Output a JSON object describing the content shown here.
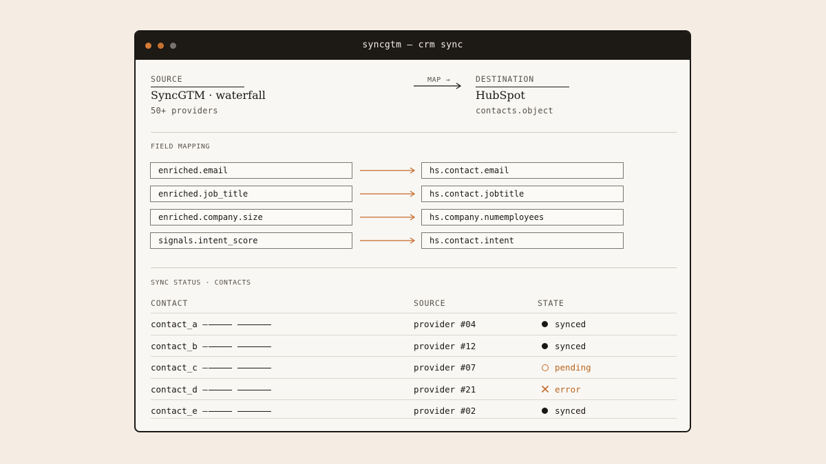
{
  "window": {
    "title": "syncgtm — crm sync"
  },
  "source": {
    "label": "SOURCE",
    "name": "SyncGTM · waterfall",
    "detail": "50+ providers"
  },
  "map_label": "MAP →",
  "destination": {
    "label": "DESTINATION",
    "name": "HubSpot",
    "detail": "contacts.object"
  },
  "field_mapping": {
    "heading": "FIELD MAPPING",
    "rows": [
      {
        "from": "enriched.email",
        "to": "hs.contact.email"
      },
      {
        "from": "enriched.job_title",
        "to": "hs.contact.jobtitle"
      },
      {
        "from": "enriched.company.size",
        "to": "hs.company.numemployees"
      },
      {
        "from": "signals.intent_score",
        "to": "hs.contact.intent"
      }
    ]
  },
  "sync_status": {
    "heading": "SYNC STATUS · CONTACTS",
    "columns": [
      "CONTACT",
      "SOURCE",
      "STATE"
    ],
    "rows": [
      {
        "contact": "contact_a —",
        "source": "provider #04",
        "state": "synced",
        "state_icon": "filled-dot-icon"
      },
      {
        "contact": "contact_b —",
        "source": "provider #12",
        "state": "synced",
        "state_icon": "filled-dot-icon"
      },
      {
        "contact": "contact_c —",
        "source": "provider #07",
        "state": "pending",
        "state_icon": "hollow-circle-icon"
      },
      {
        "contact": "contact_d —",
        "source": "provider #21",
        "state": "error",
        "state_icon": "x-icon"
      },
      {
        "contact": "contact_e —",
        "source": "provider #02",
        "state": "synced",
        "state_icon": "filled-dot-icon"
      }
    ]
  },
  "colors": {
    "accent": "#c46a2a",
    "background": "#f5ede3",
    "window": "#f9f7f3",
    "titlebar": "#1d1915"
  }
}
